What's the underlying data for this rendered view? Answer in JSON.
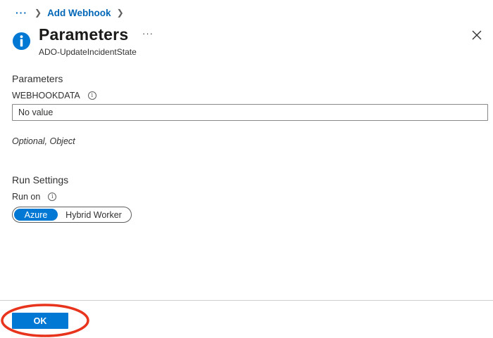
{
  "breadcrumb": {
    "ellipsis": "···",
    "current": "Add Webhook"
  },
  "header": {
    "title": "Parameters",
    "subtitle": "ADO-UpdateIncidentState",
    "more": "···"
  },
  "parameters": {
    "section_title": "Parameters",
    "field_label": "WEBHOOKDATA",
    "field_value": "No value",
    "hint": "Optional, Object"
  },
  "run_settings": {
    "section_title": "Run Settings",
    "run_on_label": "Run on",
    "options": [
      "Azure",
      "Hybrid Worker"
    ],
    "selected": "Azure"
  },
  "footer": {
    "ok_label": "OK"
  },
  "colors": {
    "accent": "#0078d4",
    "annotation": "#e8341c"
  },
  "icons": [
    "info-icon",
    "more-icon",
    "close-icon",
    "chevron-right-icon",
    "info-circle-icon"
  ]
}
